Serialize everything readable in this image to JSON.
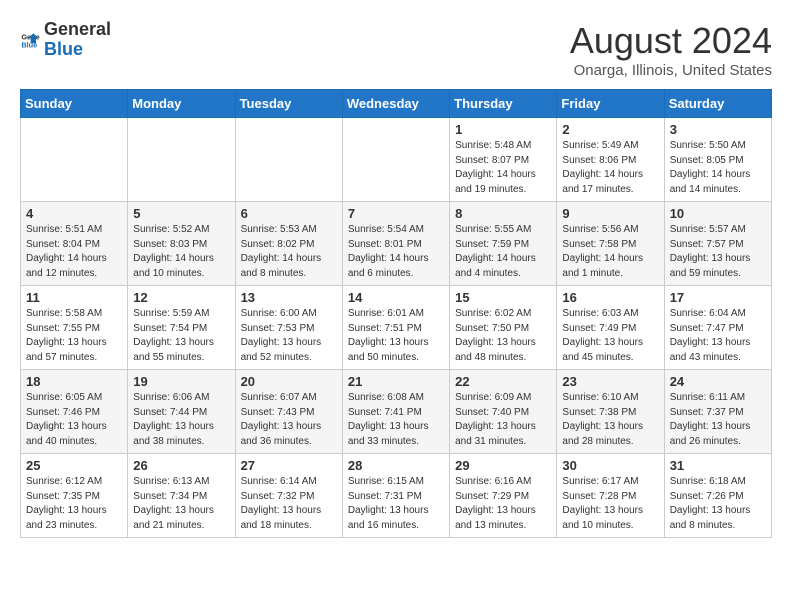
{
  "header": {
    "logo_general": "General",
    "logo_blue": "Blue",
    "main_title": "August 2024",
    "subtitle": "Onarga, Illinois, United States"
  },
  "weekdays": [
    "Sunday",
    "Monday",
    "Tuesday",
    "Wednesday",
    "Thursday",
    "Friday",
    "Saturday"
  ],
  "weeks": [
    [
      {
        "day": "",
        "info": ""
      },
      {
        "day": "",
        "info": ""
      },
      {
        "day": "",
        "info": ""
      },
      {
        "day": "",
        "info": ""
      },
      {
        "day": "1",
        "info": "Sunrise: 5:48 AM\nSunset: 8:07 PM\nDaylight: 14 hours\nand 19 minutes."
      },
      {
        "day": "2",
        "info": "Sunrise: 5:49 AM\nSunset: 8:06 PM\nDaylight: 14 hours\nand 17 minutes."
      },
      {
        "day": "3",
        "info": "Sunrise: 5:50 AM\nSunset: 8:05 PM\nDaylight: 14 hours\nand 14 minutes."
      }
    ],
    [
      {
        "day": "4",
        "info": "Sunrise: 5:51 AM\nSunset: 8:04 PM\nDaylight: 14 hours\nand 12 minutes."
      },
      {
        "day": "5",
        "info": "Sunrise: 5:52 AM\nSunset: 8:03 PM\nDaylight: 14 hours\nand 10 minutes."
      },
      {
        "day": "6",
        "info": "Sunrise: 5:53 AM\nSunset: 8:02 PM\nDaylight: 14 hours\nand 8 minutes."
      },
      {
        "day": "7",
        "info": "Sunrise: 5:54 AM\nSunset: 8:01 PM\nDaylight: 14 hours\nand 6 minutes."
      },
      {
        "day": "8",
        "info": "Sunrise: 5:55 AM\nSunset: 7:59 PM\nDaylight: 14 hours\nand 4 minutes."
      },
      {
        "day": "9",
        "info": "Sunrise: 5:56 AM\nSunset: 7:58 PM\nDaylight: 14 hours\nand 1 minute."
      },
      {
        "day": "10",
        "info": "Sunrise: 5:57 AM\nSunset: 7:57 PM\nDaylight: 13 hours\nand 59 minutes."
      }
    ],
    [
      {
        "day": "11",
        "info": "Sunrise: 5:58 AM\nSunset: 7:55 PM\nDaylight: 13 hours\nand 57 minutes."
      },
      {
        "day": "12",
        "info": "Sunrise: 5:59 AM\nSunset: 7:54 PM\nDaylight: 13 hours\nand 55 minutes."
      },
      {
        "day": "13",
        "info": "Sunrise: 6:00 AM\nSunset: 7:53 PM\nDaylight: 13 hours\nand 52 minutes."
      },
      {
        "day": "14",
        "info": "Sunrise: 6:01 AM\nSunset: 7:51 PM\nDaylight: 13 hours\nand 50 minutes."
      },
      {
        "day": "15",
        "info": "Sunrise: 6:02 AM\nSunset: 7:50 PM\nDaylight: 13 hours\nand 48 minutes."
      },
      {
        "day": "16",
        "info": "Sunrise: 6:03 AM\nSunset: 7:49 PM\nDaylight: 13 hours\nand 45 minutes."
      },
      {
        "day": "17",
        "info": "Sunrise: 6:04 AM\nSunset: 7:47 PM\nDaylight: 13 hours\nand 43 minutes."
      }
    ],
    [
      {
        "day": "18",
        "info": "Sunrise: 6:05 AM\nSunset: 7:46 PM\nDaylight: 13 hours\nand 40 minutes."
      },
      {
        "day": "19",
        "info": "Sunrise: 6:06 AM\nSunset: 7:44 PM\nDaylight: 13 hours\nand 38 minutes."
      },
      {
        "day": "20",
        "info": "Sunrise: 6:07 AM\nSunset: 7:43 PM\nDaylight: 13 hours\nand 36 minutes."
      },
      {
        "day": "21",
        "info": "Sunrise: 6:08 AM\nSunset: 7:41 PM\nDaylight: 13 hours\nand 33 minutes."
      },
      {
        "day": "22",
        "info": "Sunrise: 6:09 AM\nSunset: 7:40 PM\nDaylight: 13 hours\nand 31 minutes."
      },
      {
        "day": "23",
        "info": "Sunrise: 6:10 AM\nSunset: 7:38 PM\nDaylight: 13 hours\nand 28 minutes."
      },
      {
        "day": "24",
        "info": "Sunrise: 6:11 AM\nSunset: 7:37 PM\nDaylight: 13 hours\nand 26 minutes."
      }
    ],
    [
      {
        "day": "25",
        "info": "Sunrise: 6:12 AM\nSunset: 7:35 PM\nDaylight: 13 hours\nand 23 minutes."
      },
      {
        "day": "26",
        "info": "Sunrise: 6:13 AM\nSunset: 7:34 PM\nDaylight: 13 hours\nand 21 minutes."
      },
      {
        "day": "27",
        "info": "Sunrise: 6:14 AM\nSunset: 7:32 PM\nDaylight: 13 hours\nand 18 minutes."
      },
      {
        "day": "28",
        "info": "Sunrise: 6:15 AM\nSunset: 7:31 PM\nDaylight: 13 hours\nand 16 minutes."
      },
      {
        "day": "29",
        "info": "Sunrise: 6:16 AM\nSunset: 7:29 PM\nDaylight: 13 hours\nand 13 minutes."
      },
      {
        "day": "30",
        "info": "Sunrise: 6:17 AM\nSunset: 7:28 PM\nDaylight: 13 hours\nand 10 minutes."
      },
      {
        "day": "31",
        "info": "Sunrise: 6:18 AM\nSunset: 7:26 PM\nDaylight: 13 hours\nand 8 minutes."
      }
    ]
  ]
}
